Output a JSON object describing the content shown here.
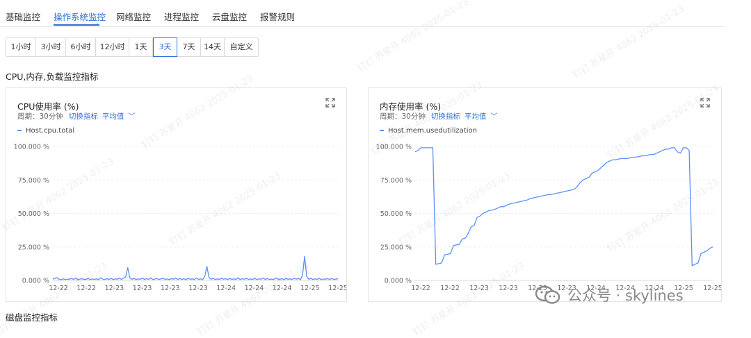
{
  "tabs": [
    {
      "label": "基础监控"
    },
    {
      "label": "操作系统监控",
      "active": true
    },
    {
      "label": "网络监控"
    },
    {
      "label": "进程监控"
    },
    {
      "label": "云盘监控"
    },
    {
      "label": "报警规则"
    }
  ],
  "time_ranges": [
    {
      "label": "1小时"
    },
    {
      "label": "3小时"
    },
    {
      "label": "6小时"
    },
    {
      "label": "12小时"
    },
    {
      "label": "1天"
    },
    {
      "label": "3天",
      "active": true
    },
    {
      "label": "7天"
    },
    {
      "label": "14天"
    },
    {
      "label": "自定义"
    }
  ],
  "section": {
    "cpu_title": "CPU,内存,负载监控指标",
    "disk_title": "磁盘监控指标"
  },
  "colors": {
    "accent": "#2b6fd6",
    "series": "#5b8ff9"
  },
  "icons": {
    "expand": "expand-icon",
    "chevron": "chevron-down-icon"
  },
  "watermark": {
    "text": "钉钉 苏星开 4062 2025-01-23"
  },
  "brand": {
    "text": "公众号 · skylines",
    "icon": "wechat-icon"
  },
  "cards": [
    {
      "title": "CPU使用率 (%)",
      "period": "周期：30分钟",
      "switch_label": "切换指标",
      "agg_label": "平均值",
      "legend": "Host.cpu.total"
    },
    {
      "title": "内存使用率 (%)",
      "period": "周期：30分钟",
      "switch_label": "切换指标",
      "agg_label": "平均值",
      "legend": "Host.mem.usedutilization"
    }
  ],
  "chart_data": [
    {
      "type": "line",
      "series": [
        {
          "name": "Host.cpu.total",
          "values": [
            1,
            1.5,
            2,
            0.8,
            0.5,
            1.2,
            0.6,
            1,
            0.9,
            1.4,
            0.7,
            1.8,
            0.6,
            1,
            1.3,
            0.7,
            0.9,
            1.5,
            0.6,
            1.1,
            0.8,
            1.2,
            0.5,
            1.9,
            1,
            0.7,
            1.3,
            0.8,
            1.5,
            0.6,
            1.2,
            0.9,
            1.6,
            0.7,
            1.8,
            2.5,
            9.5,
            2,
            0.8,
            1.5,
            0.6,
            1.1,
            0.9,
            1.7,
            0.7,
            1.3,
            0.8,
            1.9,
            0.6,
            1,
            1.4,
            0.7,
            1.2,
            1.6,
            0.8,
            1.1,
            0.6,
            1.3,
            0.9,
            1.7,
            0.7,
            1.4,
            0.8,
            1.2,
            0.6,
            1.5,
            0.9,
            1.1,
            0.7,
            1.8,
            0.8,
            1.2,
            0.6,
            3,
            10.5,
            2.5,
            0.9,
            1.5,
            0.7,
            1.1,
            0.8,
            1.6,
            0.9,
            1.3,
            0.6,
            1.5,
            0.8,
            1.2,
            0.7,
            1.9,
            0.6,
            1.3,
            0.9,
            1.6,
            0.7,
            1.1,
            0.8,
            1.5,
            0.6,
            1.2,
            0.9,
            1.8,
            0.7,
            1.4,
            0.8,
            1,
            0.6,
            1.7,
            1.1,
            0.8,
            1.3,
            0.6,
            1.5,
            0.9,
            1.2,
            0.7,
            1.6,
            0.9,
            1.4,
            0.6,
            4,
            18,
            3,
            0.9,
            1.4,
            0.7,
            1.2,
            0.8,
            1.5,
            0.6,
            1.1,
            0.9,
            1.3,
            0.8,
            1.4,
            0.7,
            1,
            1.2
          ]
        }
      ],
      "x_ticks": [
        "12-22",
        "12-22",
        "12-23",
        "12-23",
        "12-23",
        "12-23",
        "12-24",
        "12-24",
        "12-24",
        "12-25",
        "12-25"
      ],
      "y_ticks": [
        "0.000 %",
        "25.000 %",
        "50.000 %",
        "75.000 %",
        "100.000 %"
      ],
      "ylim": [
        0,
        100
      ],
      "grid": true
    },
    {
      "type": "line",
      "series": [
        {
          "name": "Host.mem.usedutilization",
          "values": [
            96,
            97,
            99,
            99,
            99,
            99,
            99,
            12,
            12.5,
            13,
            19,
            19.5,
            20,
            26,
            26.5,
            27,
            31,
            31.5,
            35,
            40,
            41,
            47,
            48,
            50,
            51,
            52,
            52.5,
            53,
            54,
            55,
            55,
            56,
            57,
            57.5,
            58,
            58.5,
            59,
            59.5,
            60,
            61,
            61.5,
            62,
            62.5,
            63,
            63.5,
            64,
            64,
            64.5,
            65,
            65.5,
            66,
            66.5,
            67,
            67.5,
            68,
            70,
            73,
            75,
            76,
            77,
            80,
            81,
            82,
            84,
            86,
            88,
            89,
            90,
            90,
            90.5,
            91,
            91,
            91,
            91.5,
            92,
            92,
            92.5,
            93,
            93,
            93.5,
            94,
            94,
            95,
            96,
            97,
            98,
            98,
            99,
            99,
            96,
            95,
            99,
            99,
            97,
            11,
            12,
            13,
            20,
            21,
            22,
            24,
            25
          ]
        }
      ],
      "x_ticks": [
        "12-22",
        "12-22",
        "12-23",
        "12-23",
        "12-23",
        "12-23",
        "12-24",
        "12-24",
        "12-24",
        "12-25",
        "12-25"
      ],
      "y_ticks": [
        "0.000 %",
        "25.000 %",
        "50.000 %",
        "75.000 %",
        "100.000 %"
      ],
      "ylim": [
        0,
        100
      ],
      "grid": true
    }
  ]
}
